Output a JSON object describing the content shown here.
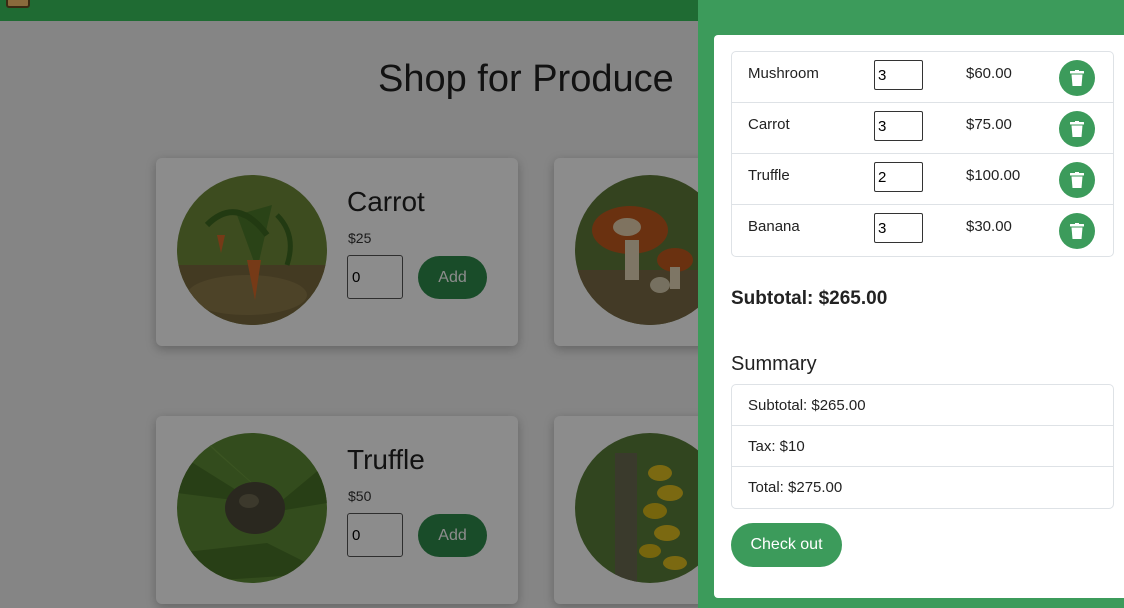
{
  "shop": {
    "title": "Shop for Produce",
    "add_label": "Add",
    "products": [
      {
        "name": "Carrot",
        "price": "$25",
        "qty": "0"
      },
      {
        "name": "Mushroom",
        "price": "",
        "qty": ""
      },
      {
        "name": "Truffle",
        "price": "$50",
        "qty": "0"
      },
      {
        "name": "Banana",
        "price": "",
        "qty": ""
      }
    ]
  },
  "cart": {
    "items": [
      {
        "name": "Mushroom",
        "qty": "3",
        "amount": "$60.00"
      },
      {
        "name": "Carrot",
        "qty": "3",
        "amount": "$75.00"
      },
      {
        "name": "Truffle",
        "qty": "2",
        "amount": "$100.00"
      },
      {
        "name": "Banana",
        "qty": "3",
        "amount": "$30.00"
      }
    ],
    "subtotal": "Subtotal: $265.00",
    "summary_title": "Summary",
    "summary": {
      "subtotal": "Subtotal: $265.00",
      "tax": "Tax: $10",
      "total": "Total: $275.00"
    },
    "checkout_label": "Check out"
  },
  "colors": {
    "brand_green": "#3c9b5b",
    "dark_green": "#1f6b33"
  }
}
